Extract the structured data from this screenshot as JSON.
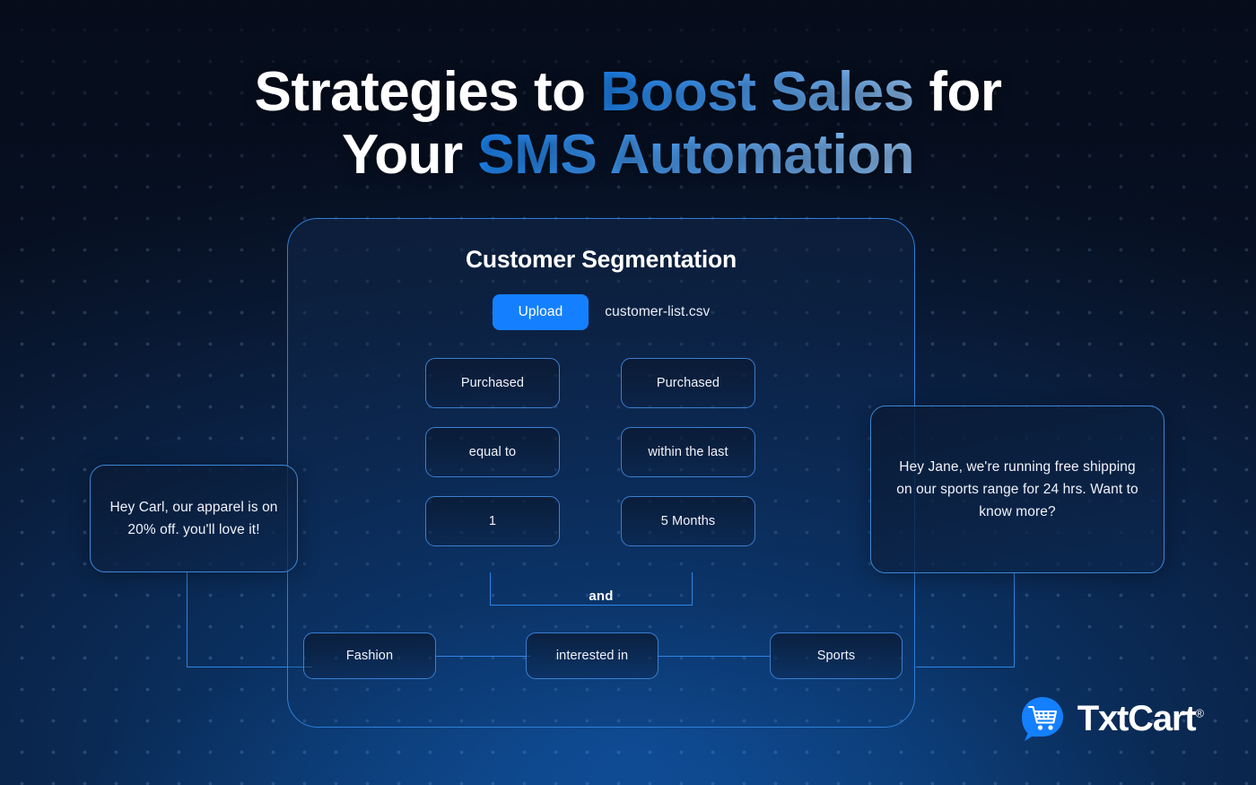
{
  "title": {
    "line1_part1": "Strategies to ",
    "line1_accent": "Boost Sales",
    "line1_part2": " for",
    "line2_part1": "Your ",
    "line2_accent": "SMS Automation"
  },
  "card": {
    "heading": "Customer Segmentation",
    "upload_label": "Upload",
    "file_name": "customer-list.csv",
    "conditions": [
      {
        "field": "Purchased",
        "operator": "equal to",
        "value": "1"
      },
      {
        "field": "Purchased",
        "operator": "within the last",
        "value": "5 Months"
      }
    ],
    "join_label": "and",
    "interest_row": {
      "left_tag": "Fashion",
      "operator": "interested in",
      "right_tag": "Sports"
    }
  },
  "bubbles": {
    "left": "Hey Carl, our apparel is on 20% off. you'll love it!",
    "right": "Hey Jane, we're running free shipping on our sports range for 24 hrs. Want to know more?"
  },
  "logo": {
    "name": "TxtCart",
    "registered": "®",
    "icon": "chat-cart-icon"
  },
  "colors": {
    "accent_blue": "#1d8bfd",
    "accent_blue_light": "#93c4f7",
    "upload_button": "#1480ff",
    "card_border": "#2f7fd8",
    "box_border": "#3b7fd0",
    "background_dark": "#071022",
    "background_center": "#0d4386",
    "text_primary": "#ffffff"
  }
}
